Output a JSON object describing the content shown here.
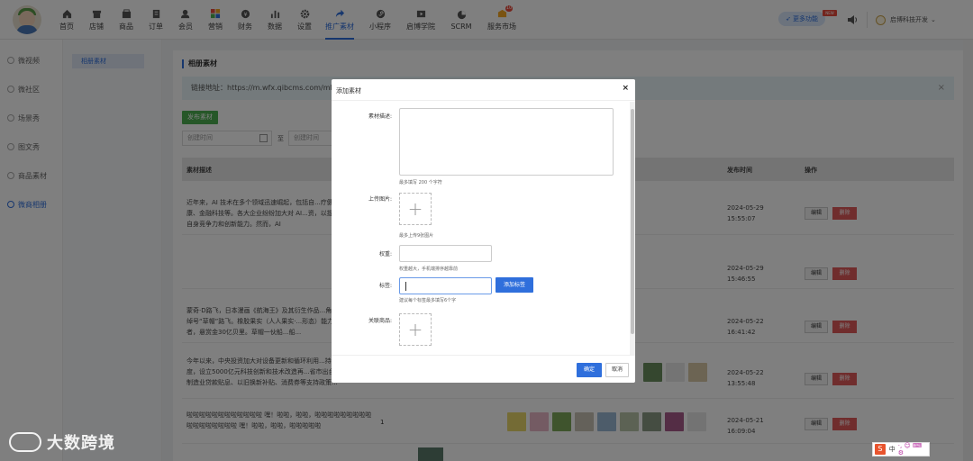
{
  "nav": {
    "items": [
      {
        "label": "首页",
        "icon": "home-icon"
      },
      {
        "label": "店铺",
        "icon": "store-icon"
      },
      {
        "label": "商品",
        "icon": "goods-icon"
      },
      {
        "label": "订单",
        "icon": "order-icon"
      },
      {
        "label": "会员",
        "icon": "member-icon"
      },
      {
        "label": "营销",
        "icon": "marketing-icon"
      },
      {
        "label": "财务",
        "icon": "finance-icon"
      },
      {
        "label": "数据",
        "icon": "data-icon"
      },
      {
        "label": "设置",
        "icon": "settings-icon"
      },
      {
        "label": "推广素材",
        "icon": "share-icon"
      },
      {
        "label": "小程序",
        "icon": "miniapp-icon"
      },
      {
        "label": "启博学院",
        "icon": "academy-icon"
      },
      {
        "label": "SCRM",
        "icon": "scrm-icon"
      },
      {
        "label": "服务市场",
        "icon": "market-icon"
      }
    ],
    "market_badge": "10",
    "more_label": "更多功能",
    "new_tag": "NEW",
    "company": "启博科技开发"
  },
  "sidebar": {
    "items": [
      "微视频",
      "微社区",
      "场景秀",
      "图文秀",
      "商品素材",
      "微商相册"
    ]
  },
  "sub_sidebar": {
    "active": "相册素材"
  },
  "main": {
    "title": "相册素材",
    "link_text": "链接地址：https://m.wfx.qibcms.com/mb",
    "publish": "发布素材",
    "date_start": "创建时间",
    "to": "至",
    "date_end": "创建时间",
    "columns": {
      "desc": "素材描述",
      "time": "发布时间",
      "ops": "操作"
    },
    "edit": "编辑",
    "delete": "删除",
    "rows": [
      {
        "desc": "近年来，AI 技术在多个领域迅速崛起，包括自...疗健康、金融科技等。各大企业纷纷加大对 AI...资，以提高自身竞争力和创新能力。然而，AI",
        "date": "2024-05-29",
        "clock": "15:55:07"
      },
      {
        "desc": "",
        "date": "2024-05-29",
        "clock": "15:46:55"
      },
      {
        "desc": "蒙奇·D路飞，日本漫画《航海王》及其衍生作品...角，绰号“草帽”路飞。橡胶果实（人人果实·...形态）能力者，悬赏金30亿贝里。草帽一伙船...船...",
        "date": "2024-05-22",
        "clock": "16:41:42"
      },
      {
        "desc": "今年以来，中央投资加大对设备更新和循环利用...持力度，设立5000亿元科技创新和技术改造再...省市出台制造业贷款贴息、以旧换新补贴、消费券等支持政策...",
        "date": "2024-05-22",
        "clock": "13:55:48"
      },
      {
        "desc": "啦啦啦啦啦啦啦啦啦啦啦啦 嘿！啦啦，啦啦，啦啦啦啦啦啦啦啦啦啦啦啦啦啦啦啦啦 嘿！啦啦，啦啦，啦啦啦啦啦",
        "num": "1",
        "date": "2024-05-21",
        "clock": "16:09:04"
      }
    ]
  },
  "modal": {
    "title": "添加素材",
    "close": "×",
    "desc_label": "素材描述:",
    "desc_hint": "最多填写 200 个字符",
    "image_label": "上传图片:",
    "image_hint": "最多上传9张图片",
    "weight_label": "权重:",
    "weight_hint": "权重越大，手机端排序越靠前",
    "tag_label": "标签:",
    "add_tag": "添加标签",
    "tag_hint": "建议每个标签最多填写6个字",
    "product_label": "关联商品:",
    "plus": "+",
    "ok": "确定",
    "cancel": "取消"
  },
  "watermark": "大数跨境",
  "ime": {
    "label": "中",
    "extra": "·, ☺ ⌨ ⚙"
  },
  "colors": {
    "accent": "#2f6fdc",
    "publish": "#4caf50",
    "danger": "#e05a5a"
  }
}
